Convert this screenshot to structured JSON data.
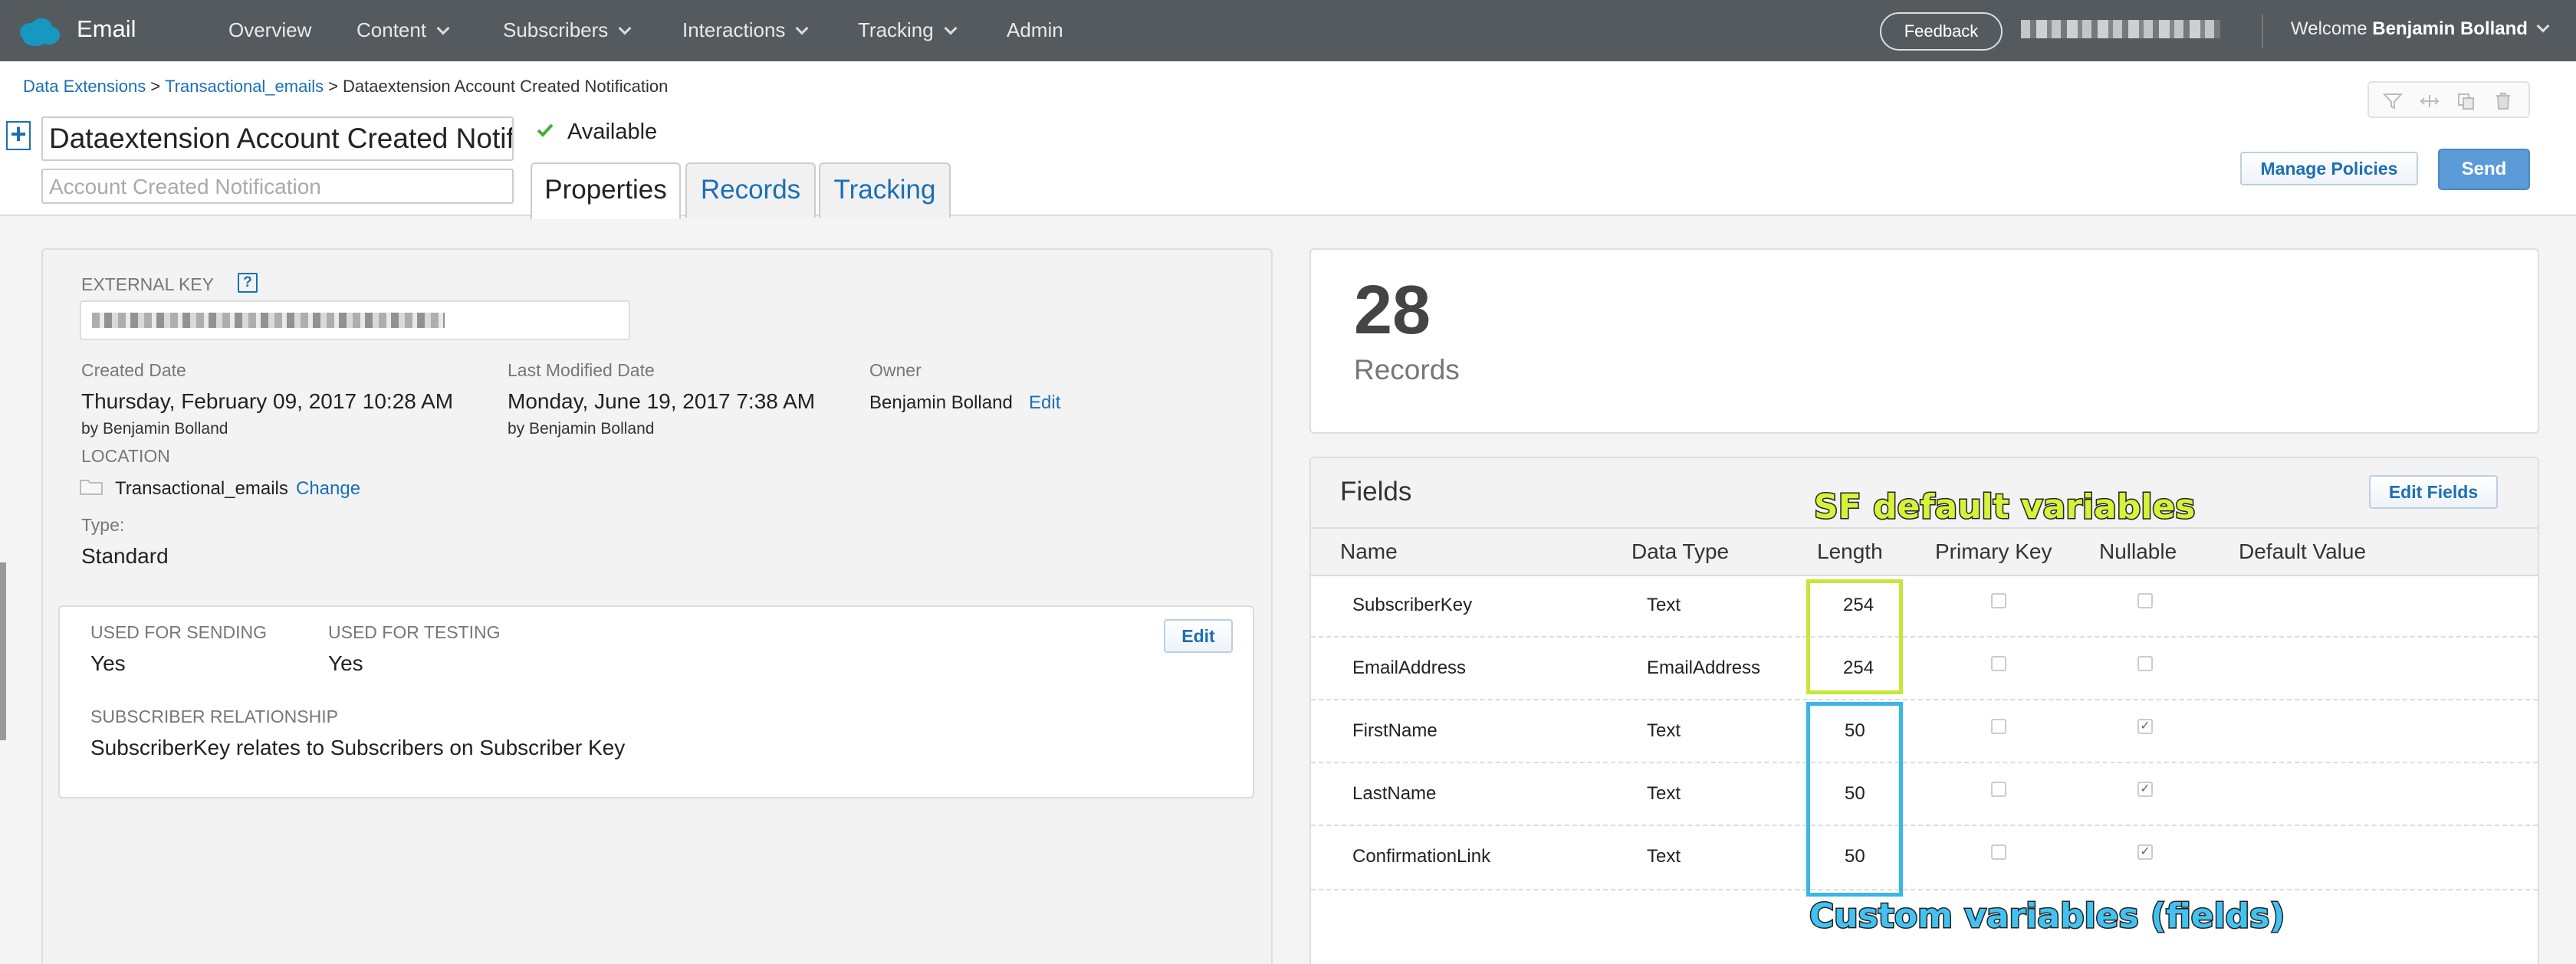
{
  "topbar": {
    "app_name": "Email",
    "nav": [
      "Overview",
      "Content",
      "Subscribers",
      "Interactions",
      "Tracking",
      "Admin"
    ],
    "feedback_label": "Feedback",
    "welcome_prefix": "Welcome",
    "user_name": "Benjamin Bolland"
  },
  "breadcrumb": {
    "items": [
      "Data Extensions",
      "Transactional_emails"
    ],
    "separator": ">",
    "current": "Dataextension Account Created Notification"
  },
  "header": {
    "plus_label": "+",
    "title_value": "Dataextension Account Created Notification",
    "description_placeholder": "Account Created Notification",
    "status": "Available",
    "tabs": [
      "Properties",
      "Records",
      "Tracking"
    ],
    "active_tab": "Properties",
    "manage_policies_label": "Manage Policies",
    "send_label": "Send"
  },
  "properties": {
    "external_key_label": "EXTERNAL KEY",
    "help_label": "?",
    "created_label": "Created Date",
    "created_value": "Thursday, February 09, 2017 10:28 AM",
    "created_by": "by Benjamin Bolland",
    "modified_label": "Last Modified Date",
    "modified_value": "Monday, June 19, 2017 7:38 AM",
    "modified_by": "by Benjamin Bolland",
    "owner_label": "Owner",
    "owner_value": "Benjamin Bolland",
    "owner_edit": "Edit",
    "location_label": "LOCATION",
    "location_value": "Transactional_emails",
    "location_change": "Change",
    "type_label": "Type:",
    "type_value": "Standard"
  },
  "sending": {
    "used_sending_label": "USED FOR SENDING",
    "used_sending_value": "Yes",
    "used_testing_label": "USED FOR TESTING",
    "used_testing_value": "Yes",
    "relationship_label": "SUBSCRIBER RELATIONSHIP",
    "relationship_value": "SubscriberKey relates to Subscribers on Subscriber Key",
    "edit_label": "Edit"
  },
  "records": {
    "count": "28",
    "label": "Records"
  },
  "fields": {
    "title": "Fields",
    "edit_label": "Edit Fields",
    "columns": [
      "Name",
      "Data Type",
      "Length",
      "Primary Key",
      "Nullable",
      "Default Value"
    ],
    "rows": [
      {
        "name": "SubscriberKey",
        "type": "Text",
        "length": "254",
        "primary": false,
        "nullable": false
      },
      {
        "name": "EmailAddress",
        "type": "EmailAddress",
        "length": "254",
        "primary": false,
        "nullable": false
      },
      {
        "name": "FirstName",
        "type": "Text",
        "length": "50",
        "primary": false,
        "nullable": true
      },
      {
        "name": "LastName",
        "type": "Text",
        "length": "50",
        "primary": false,
        "nullable": true
      },
      {
        "name": "ConfirmationLink",
        "type": "Text",
        "length": "50",
        "primary": false,
        "nullable": true
      }
    ]
  },
  "annotations": {
    "sf_default": "SF default variables",
    "custom": "Custom variables (fields)",
    "green": "#c6e63a",
    "blue": "#39b7e6"
  },
  "colors": {
    "topbar": "#555a5f",
    "link": "#1a6fb5",
    "send": "#5b9bd8"
  }
}
